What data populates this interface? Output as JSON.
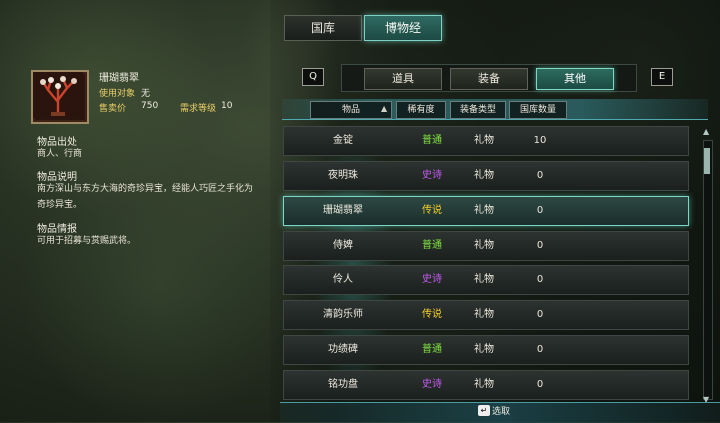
{
  "colors": {
    "common": "#7fe23f",
    "epic": "#c45bf0",
    "legend": "#f2cc2c"
  },
  "top_tabs": [
    {
      "label": "国库",
      "active": false
    },
    {
      "label": "博物经",
      "active": true
    }
  ],
  "item": {
    "name": "珊瑚翡翠",
    "target_label": "使用对象",
    "target_value": "无",
    "price_label": "售卖价",
    "price_value": "750",
    "level_label": "需求等级",
    "level_value": "10",
    "source_title": "物品出处",
    "source_text": "商人、行商",
    "desc_title": "物品说明",
    "desc_text": "南方深山与东方大海的奇珍异宝，经能人巧匠之手化为奇珍异宝。",
    "info_title": "物品情报",
    "info_text": "可用于招募与赏赐武将。"
  },
  "nav": {
    "left_key": "Q",
    "right_key": "E"
  },
  "categories": [
    {
      "label": "道具",
      "active": false
    },
    {
      "label": "装备",
      "active": false
    },
    {
      "label": "其他",
      "active": true
    }
  ],
  "headers": {
    "name": "物品",
    "rarity": "稀有度",
    "type": "装备类型",
    "count": "国库数量"
  },
  "rows": [
    {
      "name": "金锭",
      "rarity": "普通",
      "rarity_level": "common",
      "type": "礼物",
      "count": "10",
      "selected": false
    },
    {
      "name": "夜明珠",
      "rarity": "史诗",
      "rarity_level": "epic",
      "type": "礼物",
      "count": "0",
      "selected": false
    },
    {
      "name": "珊瑚翡翠",
      "rarity": "传说",
      "rarity_level": "legend",
      "type": "礼物",
      "count": "0",
      "selected": true
    },
    {
      "name": "侍婢",
      "rarity": "普通",
      "rarity_level": "common",
      "type": "礼物",
      "count": "0",
      "selected": false
    },
    {
      "name": "伶人",
      "rarity": "史诗",
      "rarity_level": "epic",
      "type": "礼物",
      "count": "0",
      "selected": false
    },
    {
      "name": "清韵乐师",
      "rarity": "传说",
      "rarity_level": "legend",
      "type": "礼物",
      "count": "0",
      "selected": false
    },
    {
      "name": "功绩碑",
      "rarity": "普通",
      "rarity_level": "common",
      "type": "礼物",
      "count": "0",
      "selected": false
    },
    {
      "name": "铭功盘",
      "rarity": "史诗",
      "rarity_level": "epic",
      "type": "礼物",
      "count": "0",
      "selected": false
    }
  ],
  "footer": {
    "key": "↵",
    "label": "选取"
  }
}
